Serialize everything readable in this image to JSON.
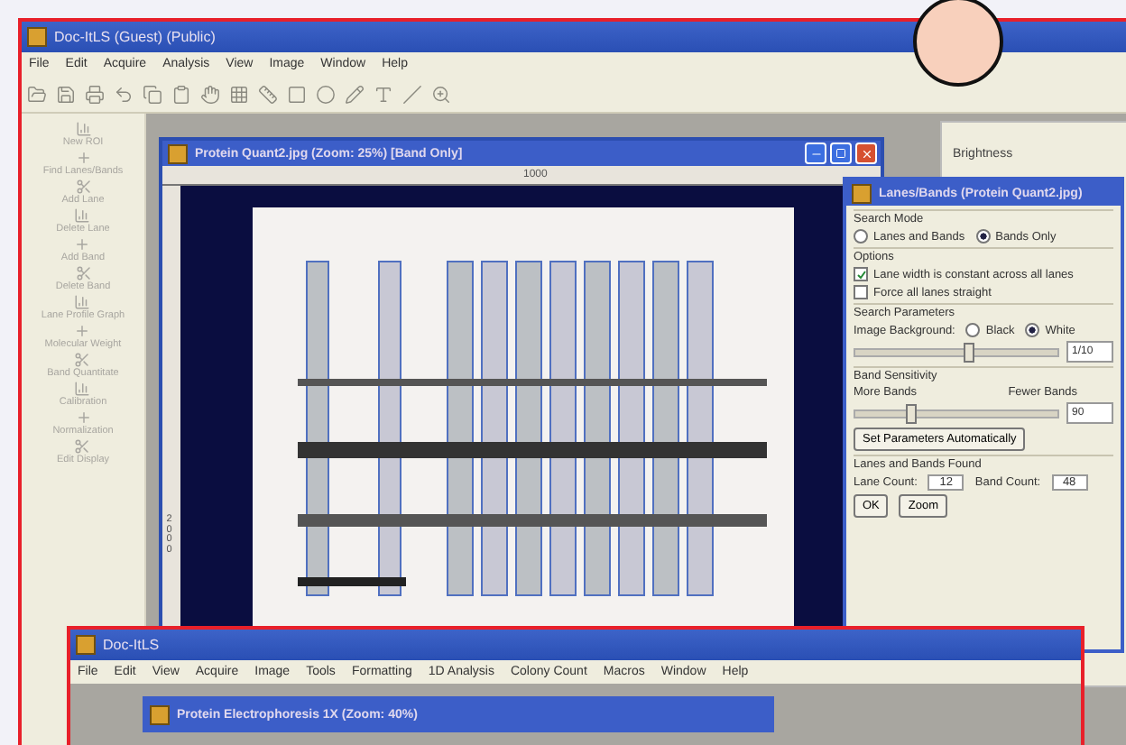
{
  "window": {
    "title": "Doc-ItLS (Guest) (Public)"
  },
  "menu": [
    "File",
    "Edit",
    "Acquire",
    "Analysis",
    "View",
    "Image",
    "Window",
    "Help"
  ],
  "sidebar": {
    "items": [
      "New ROI",
      "Find Lanes/Bands",
      "Add Lane",
      "Delete Lane",
      "Add Band",
      "Delete Band",
      "Lane Profile Graph",
      "Molecular Weight",
      "Band Quantitate",
      "Calibration",
      "Normalization",
      "Edit Display"
    ]
  },
  "right_panel": {
    "title": "Brightness"
  },
  "image_window": {
    "title": "Protein Quant2.jpg  (Zoom: 25%) [Band Only]",
    "ruler_h": "1000",
    "ruler_v": "2000"
  },
  "dialog": {
    "title": "Lanes/Bands (Protein Quant2.jpg)",
    "search_mode": {
      "label": "Search Mode",
      "options": [
        {
          "label": "Lanes and Bands",
          "selected": false
        },
        {
          "label": "Bands Only",
          "selected": true
        }
      ]
    },
    "options": {
      "label": "Options",
      "items": [
        {
          "label": "Lane width is constant across all lanes",
          "checked": true
        },
        {
          "label": "Force all lanes straight",
          "checked": false
        }
      ]
    },
    "search_parameters": {
      "label": "Search Parameters",
      "background_label": "Image Background:",
      "backgrounds": [
        {
          "label": "Black",
          "selected": false
        },
        {
          "label": "White",
          "selected": true
        }
      ],
      "slider": {
        "level": 0.55,
        "value": "1/10"
      }
    },
    "band_sensitivity": {
      "label": "Band Sensitivity",
      "left": "More Bands",
      "right": "Fewer Bands",
      "level": 0.27,
      "value": "90"
    },
    "auto_button": "Set Parameters Automatically",
    "found": {
      "label": "Lanes and Bands Found",
      "lane_label": "Lane Count:",
      "lane_count": "12",
      "band_label": "Band Count:",
      "band_count": "48"
    },
    "buttons": [
      "OK",
      "Zoom"
    ]
  },
  "second_window": {
    "title": "Doc-ItLS",
    "menu": [
      "File",
      "Edit",
      "View",
      "Acquire",
      "Image",
      "Tools",
      "Formatting",
      "1D Analysis",
      "Colony Count",
      "Macros",
      "Window",
      "Help"
    ],
    "inner_title": "Protein Electrophoresis 1X (Zoom: 40%)"
  }
}
